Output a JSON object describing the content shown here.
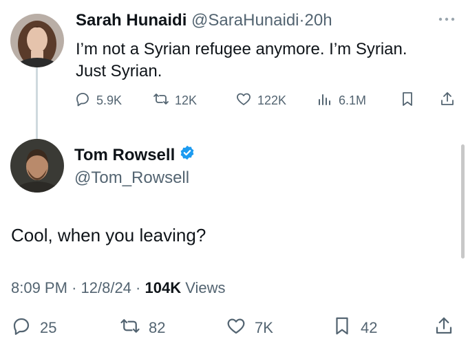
{
  "parent_tweet": {
    "name": "Sarah Hunaidi",
    "handle": "@SaraHunaidi",
    "separator": "·",
    "time": "20h",
    "text_line1": "I’m not a Syrian refugee anymore. I’m Syrian.",
    "text_line2": "Just Syrian.",
    "replies": "5.9K",
    "reposts": "12K",
    "likes": "122K",
    "views": "6.1M"
  },
  "reply_tweet": {
    "name": "Tom Rowsell",
    "handle": "@Tom_Rowsell",
    "text": "Cool, when you leaving?",
    "time": "8:09 PM",
    "sep1": "·",
    "date": "12/8/24",
    "sep2": "·",
    "views_count": "104K",
    "views_label": "Views",
    "replies": "25",
    "reposts": "82",
    "likes": "7K",
    "bookmarks": "42"
  },
  "colors": {
    "text": "#0f1419",
    "muted": "#536471",
    "verified": "#1d9bf0",
    "thread_line": "#cfd9de"
  },
  "icons": [
    "more-icon",
    "reply-icon",
    "repost-icon",
    "like-icon",
    "views-icon",
    "bookmark-icon",
    "share-icon",
    "verified-badge-icon"
  ]
}
